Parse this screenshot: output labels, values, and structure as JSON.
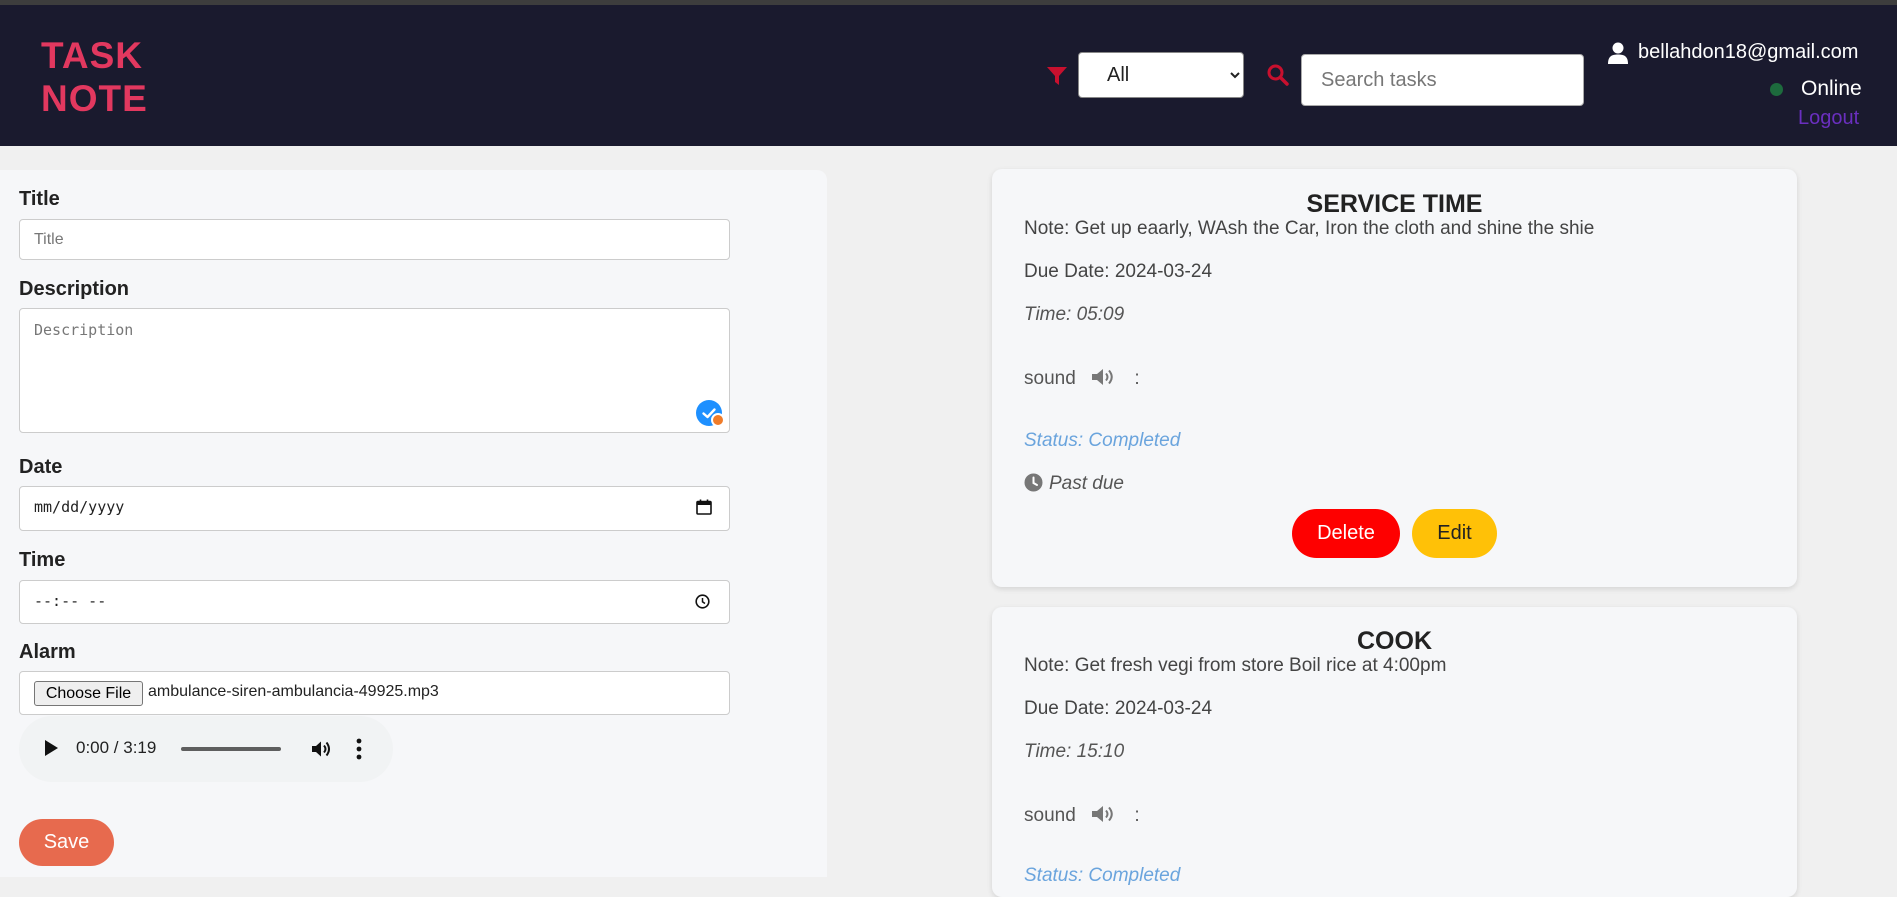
{
  "app": {
    "logo_line1": "TASK",
    "logo_line2": "NOTE"
  },
  "header": {
    "filter_value": "All",
    "search_placeholder": "Search tasks",
    "user_email": "bellahdon18@gmail.com",
    "online_status": "Online",
    "online_color": "#1d6b3d",
    "logout_label": "Logout"
  },
  "form": {
    "title_label": "Title",
    "title_placeholder": "Title",
    "description_label": "Description",
    "description_placeholder": "Description",
    "date_label": "Date",
    "date_value": "mm/dd/yyyy",
    "time_label": "Time",
    "time_value": "--:-- --",
    "alarm_label": "Alarm",
    "choose_file_label": "Choose File",
    "file_name": "ambulance-siren-ambulancia-49925.mp3",
    "audio_time": "0:00 / 3:19",
    "save_label": "Save"
  },
  "tasks": [
    {
      "title": "SERVICE TIME",
      "note": "Note: Get up eaarly, WAsh the Car, Iron the cloth and shine the shie",
      "due": "Due Date: 2024-03-24",
      "time": "Time: 05:09",
      "sound_label": "sound",
      "sound_suffix": ":",
      "status": "Status: Completed",
      "past_due": "Past due",
      "delete_label": "Delete",
      "edit_label": "Edit"
    },
    {
      "title": "COOK",
      "note": "Note: Get fresh vegi from store Boil rice at 4:00pm",
      "due": "Due Date: 2024-03-24",
      "time": "Time: 15:10",
      "sound_label": "sound",
      "sound_suffix": ":",
      "status": "Status: Completed"
    }
  ],
  "colors": {
    "header_bg": "#1a1a2e",
    "logo": "#e2385f",
    "delete": "#fe0000",
    "edit": "#ffc107",
    "save": "#e76a4e",
    "status": "#6aa4dd"
  }
}
